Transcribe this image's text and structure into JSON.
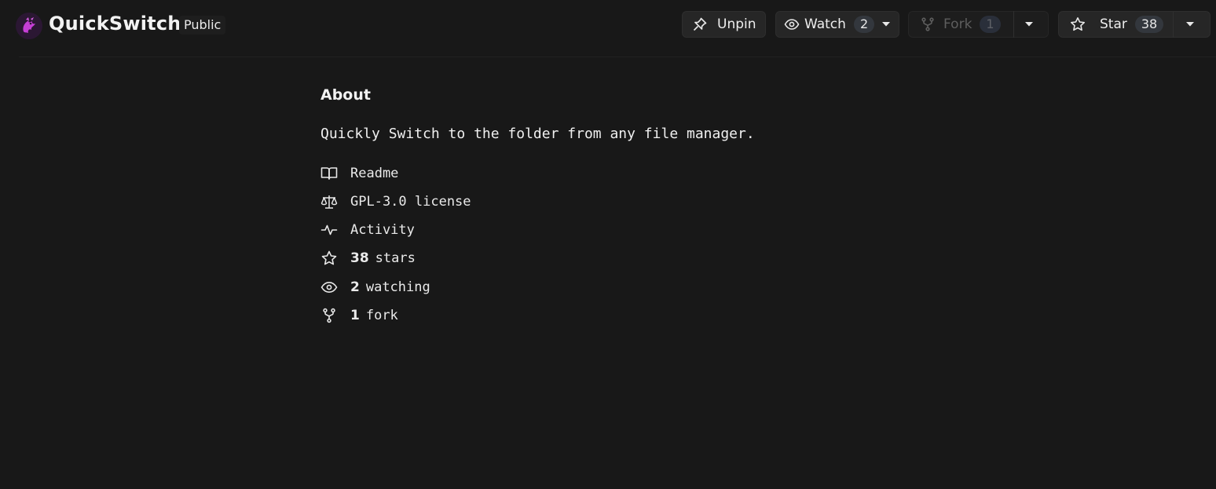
{
  "repo": {
    "name": "QuickSwitch",
    "visibility": "Public",
    "logo_icon": "dragon-logo-icon"
  },
  "actions": {
    "unpin_label": "Unpin",
    "watch_label": "Watch",
    "watch_count": "2",
    "fork_label": "Fork",
    "fork_count": "1",
    "star_label": "Star",
    "star_count": "38"
  },
  "about": {
    "title": "About",
    "description": "Quickly Switch to the folder from any file manager.",
    "readme": "Readme",
    "license": "GPL-3.0 license",
    "activity": "Activity",
    "stars_count": "38",
    "stars_label": "stars",
    "watching_count": "2",
    "watching_label": "watching",
    "forks_count": "1",
    "forks_label": "fork"
  },
  "colors": {
    "background": "#181818",
    "button": "#262626",
    "count_pill": "#33373d",
    "logo_accent": "#c03ad0"
  }
}
